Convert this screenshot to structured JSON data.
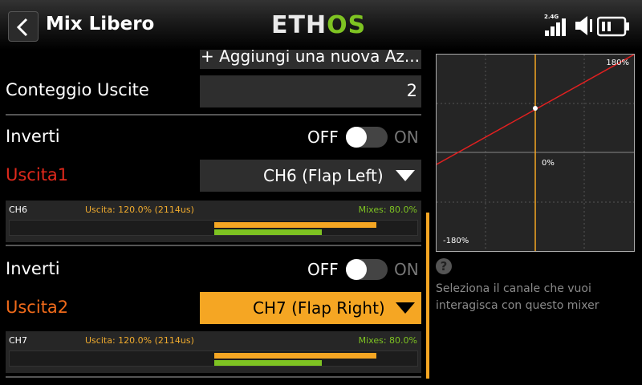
{
  "header": {
    "title": "Mix Libero",
    "logo_left": "ETH",
    "logo_right": "OS",
    "frequency": "2.4G",
    "back_icon": "chevron-left-icon",
    "signal_icon": "signal-bars-icon",
    "volume_icon": "speaker-icon",
    "battery_icon": "battery-icon"
  },
  "colors": {
    "accent_orange": "#f5a623",
    "accent_green": "#7ec322",
    "label_red": "#e0291c",
    "label_orange": "#f06a1a",
    "curve_red": "#e02020"
  },
  "form": {
    "add_button_label": "+ Aggiungi una nuova Az...",
    "output_count_label": "Conteggio Uscite",
    "output_count_value": "2",
    "outputs": [
      {
        "invert_label": "Inverti",
        "off_label": "OFF",
        "on_label": "ON",
        "invert_on": false,
        "output_label": "Uscita1",
        "channel_selected": "CH6 (Flap Left)",
        "monitor": {
          "channel": "CH6",
          "output_text": "Uscita: 120.0% (2114us)",
          "mixes_text": "Mixes: 80.0%",
          "output_percent": 120.0,
          "mixes_percent": 80.0
        }
      },
      {
        "invert_label": "Inverti",
        "off_label": "OFF",
        "on_label": "ON",
        "invert_on": false,
        "output_label": "Uscita2",
        "channel_selected": "CH7 (Flap Right)",
        "monitor": {
          "channel": "CH7",
          "output_text": "Uscita: 120.0% (2114us)",
          "mixes_text": "Mixes: 80.0%",
          "output_percent": 120.0,
          "mixes_percent": 80.0
        }
      }
    ]
  },
  "curve": {
    "top_right_label": "180%",
    "center_label": "0%",
    "bottom_left_label": "-180%",
    "current_input_percent": 0,
    "current_output_percent": 0
  },
  "help": {
    "icon": "question-icon",
    "icon_glyph": "?",
    "text": "Seleziona il canale che vuoi interagisca con questo mixer"
  }
}
